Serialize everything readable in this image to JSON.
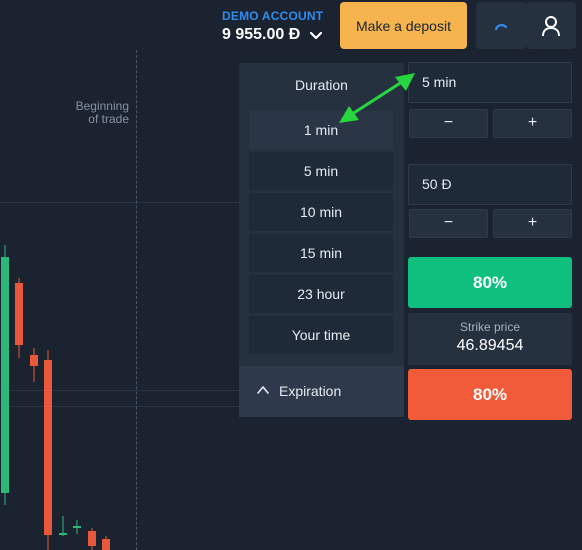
{
  "header": {
    "account_type": "DEMO ACCOUNT",
    "balance": "9 955.00 Đ",
    "deposit_label": "Make a deposit",
    "chevron_icon": "chevron-down-icon",
    "spinner_icon": "loading-spinner-icon",
    "user_icon": "user-icon"
  },
  "chart": {
    "begin_label_line1": "Beginning",
    "begin_label_line2": "of trade"
  },
  "duration_menu": {
    "title": "Duration",
    "options": [
      {
        "label": "1 min"
      },
      {
        "label": "5 min"
      },
      {
        "label": "10 min"
      },
      {
        "label": "15 min"
      },
      {
        "label": "23 hour"
      },
      {
        "label": "Your time"
      }
    ],
    "expiration_label": "Expiration"
  },
  "trade": {
    "duration_value": "5 min",
    "amount_value": "50 Đ",
    "minus_label": "−",
    "plus_label": "+",
    "buy_payout": "80%",
    "sell_payout": "80%",
    "strike_label": "Strike price",
    "strike_value": "46.89454"
  },
  "colors": {
    "background": "#1c2330",
    "panel": "#263140",
    "accent_blue": "#2d8ef0",
    "deposit": "#f5b44d",
    "buy": "#0fbf7e",
    "sell": "#f25b3a",
    "candle_up": "#2db87a",
    "candle_down": "#e8583a",
    "annotation_arrow": "#27d63e"
  }
}
